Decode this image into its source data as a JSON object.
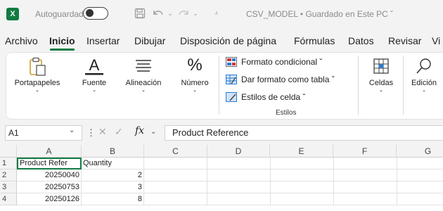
{
  "titlebar": {
    "autosave_label": "Autoguardado",
    "autosave_state": "",
    "doc_title": "CSV_MODEL • Guardado en Este PC ˇ",
    "quick_access": [
      "save-icon",
      "undo-icon",
      "redo-icon",
      "customize-icon"
    ]
  },
  "menu": {
    "tabs": [
      "Archivo",
      "Inicio",
      "Insertar",
      "Dibujar",
      "Disposición de página",
      "Fórmulas",
      "Datos",
      "Revisar",
      "Vi"
    ],
    "active": "Inicio"
  },
  "ribbon": {
    "portapapeles": "Portapapeles",
    "fuente": "Fuente",
    "alineacion": "Alineación",
    "numero": "Número",
    "formato_condicional": "Formato condicional ˇ",
    "dar_formato_tabla": "Dar formato como tabla ˇ",
    "estilos_celda": "Estilos de celda ˇ",
    "estilos_group": "Estilos",
    "celdas": "Celdas",
    "edicion": "Edición",
    "chevron": "ˇ"
  },
  "formula_bar": {
    "name_box": "A1",
    "fx": "fx",
    "value": "Product Reference"
  },
  "grid": {
    "columns": [
      "A",
      "B",
      "C",
      "D",
      "E",
      "F",
      "G"
    ],
    "rows": [
      {
        "num": "1",
        "a": "Product Refer",
        "b": "Quantity"
      },
      {
        "num": "2",
        "a": "20250040",
        "b": "2"
      },
      {
        "num": "3",
        "a": "20250753",
        "b": "3"
      },
      {
        "num": "4",
        "a": "20250126",
        "b": "8"
      }
    ]
  },
  "colors": {
    "accent": "#107c41"
  }
}
